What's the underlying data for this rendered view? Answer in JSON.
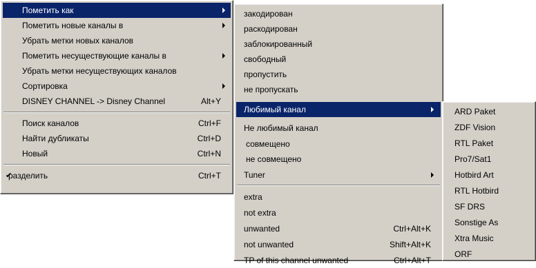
{
  "menu1": {
    "items": [
      {
        "label": "Пометить как",
        "shortcut": "",
        "submenu": true
      },
      {
        "label": "Пометить новые каналы в",
        "shortcut": "",
        "submenu": true
      },
      {
        "label": "Убрать метки новых каналов",
        "shortcut": "",
        "submenu": false
      },
      {
        "label": "Пометить несуществующие каналы в",
        "shortcut": "",
        "submenu": true
      },
      {
        "label": "Убрать метки несуществующих каналов",
        "shortcut": "",
        "submenu": false
      },
      {
        "label": "Сортировка",
        "shortcut": "",
        "submenu": true
      },
      {
        "label": "DISNEY CHANNEL -> Disney Channel",
        "shortcut": "Alt+Y",
        "submenu": false
      },
      {
        "label": "Поиск каналов",
        "shortcut": "Ctrl+F",
        "submenu": false
      },
      {
        "label": "Найти дубликаты",
        "shortcut": "Ctrl+D",
        "submenu": false
      },
      {
        "label": "Новый",
        "shortcut": "Ctrl+N",
        "submenu": false
      },
      {
        "label": "разделить",
        "shortcut": "Ctrl+T",
        "submenu": false,
        "checked": true
      }
    ],
    "check_mark": "✔"
  },
  "menu2": {
    "items": [
      {
        "label": "закодирован",
        "shortcut": ""
      },
      {
        "label": "раскодирован",
        "shortcut": ""
      },
      {
        "label": "заблокированный",
        "shortcut": ""
      },
      {
        "label": "свободный",
        "shortcut": ""
      },
      {
        "label": "пропустить",
        "shortcut": ""
      },
      {
        "label": "не пропускать",
        "shortcut": ""
      },
      {
        "label": "Любимый канал",
        "shortcut": "",
        "submenu": true
      },
      {
        "label": "Не любимый канал",
        "shortcut": ""
      },
      {
        "label": "совмещено",
        "shortcut": ""
      },
      {
        "label": "не совмещено",
        "shortcut": ""
      },
      {
        "label": "Tuner",
        "shortcut": "",
        "submenu": true
      },
      {
        "label": "extra",
        "shortcut": ""
      },
      {
        "label": "not extra",
        "shortcut": ""
      },
      {
        "label": "unwanted",
        "shortcut": "Ctrl+Alt+K"
      },
      {
        "label": "not unwanted",
        "shortcut": "Shift+Alt+K"
      },
      {
        "label": "TP of this channel unwanted",
        "shortcut": "Ctrl+Alt+T"
      }
    ]
  },
  "menu3": {
    "items": [
      "ARD Paket",
      "ZDF Vision",
      "RTL Paket",
      "Pro7/Sat1",
      "Hotbird Art",
      "RTL Hotbird",
      "SF DRS",
      "Sonstige As",
      "Xtra Music",
      "ORF"
    ]
  },
  "colors": {
    "menu_bg": "#d4d0c8",
    "highlight": "#0a246a",
    "highlight_text": "#ffffff"
  }
}
